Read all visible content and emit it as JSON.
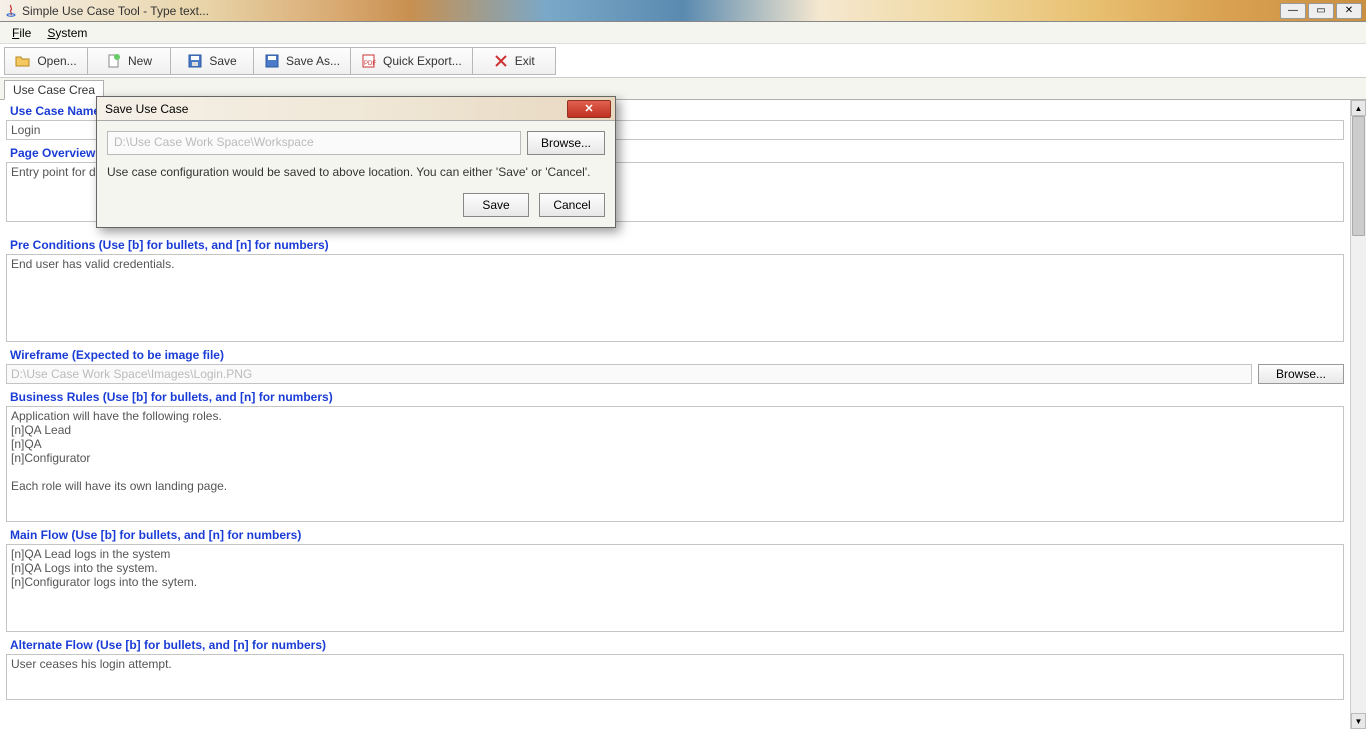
{
  "window": {
    "title": "Simple Use Case Tool - Type text..."
  },
  "menu": {
    "file": "File",
    "system": "System"
  },
  "toolbar": {
    "open": "Open...",
    "new": "New",
    "save": "Save",
    "saveas": "Save As...",
    "quickexport": "Quick Export...",
    "exit": "Exit"
  },
  "tab": {
    "active": "Use Case Crea"
  },
  "sections": {
    "usecase_name": {
      "label": "Use Case Name",
      "value": "Login"
    },
    "page_overview": {
      "label": "Page Overview",
      "value": "Entry point for di"
    },
    "preconditions": {
      "label": "Pre Conditions (Use [b] for bullets, and [n] for numbers)",
      "value": "End user has valid credentials."
    },
    "wireframe": {
      "label": "Wireframe (Expected to be image file)",
      "value": "D:\\Use Case Work Space\\Images\\Login.PNG",
      "browse": "Browse..."
    },
    "business_rules": {
      "label": "Business Rules (Use [b] for bullets, and [n] for numbers)",
      "value": "Application will have the following roles.\n[n]QA Lead\n[n]QA\n[n]Configurator\n\nEach role will have its own landing page."
    },
    "main_flow": {
      "label": "Main Flow (Use [b] for bullets, and [n] for numbers)",
      "value": "[n]QA Lead logs in the system\n[n]QA Logs into the system.\n[n]Configurator logs into the sytem."
    },
    "alternate_flow": {
      "label": "Alternate Flow (Use [b] for bullets, and [n] for numbers)",
      "value": "User ceases his login attempt."
    }
  },
  "dialog": {
    "title": "Save Use Case",
    "path": "D:\\Use Case Work Space\\Workspace",
    "browse": "Browse...",
    "message": "Use case configuration would be saved to above location. You can either 'Save' or 'Cancel'.",
    "save": "Save",
    "cancel": "Cancel"
  }
}
